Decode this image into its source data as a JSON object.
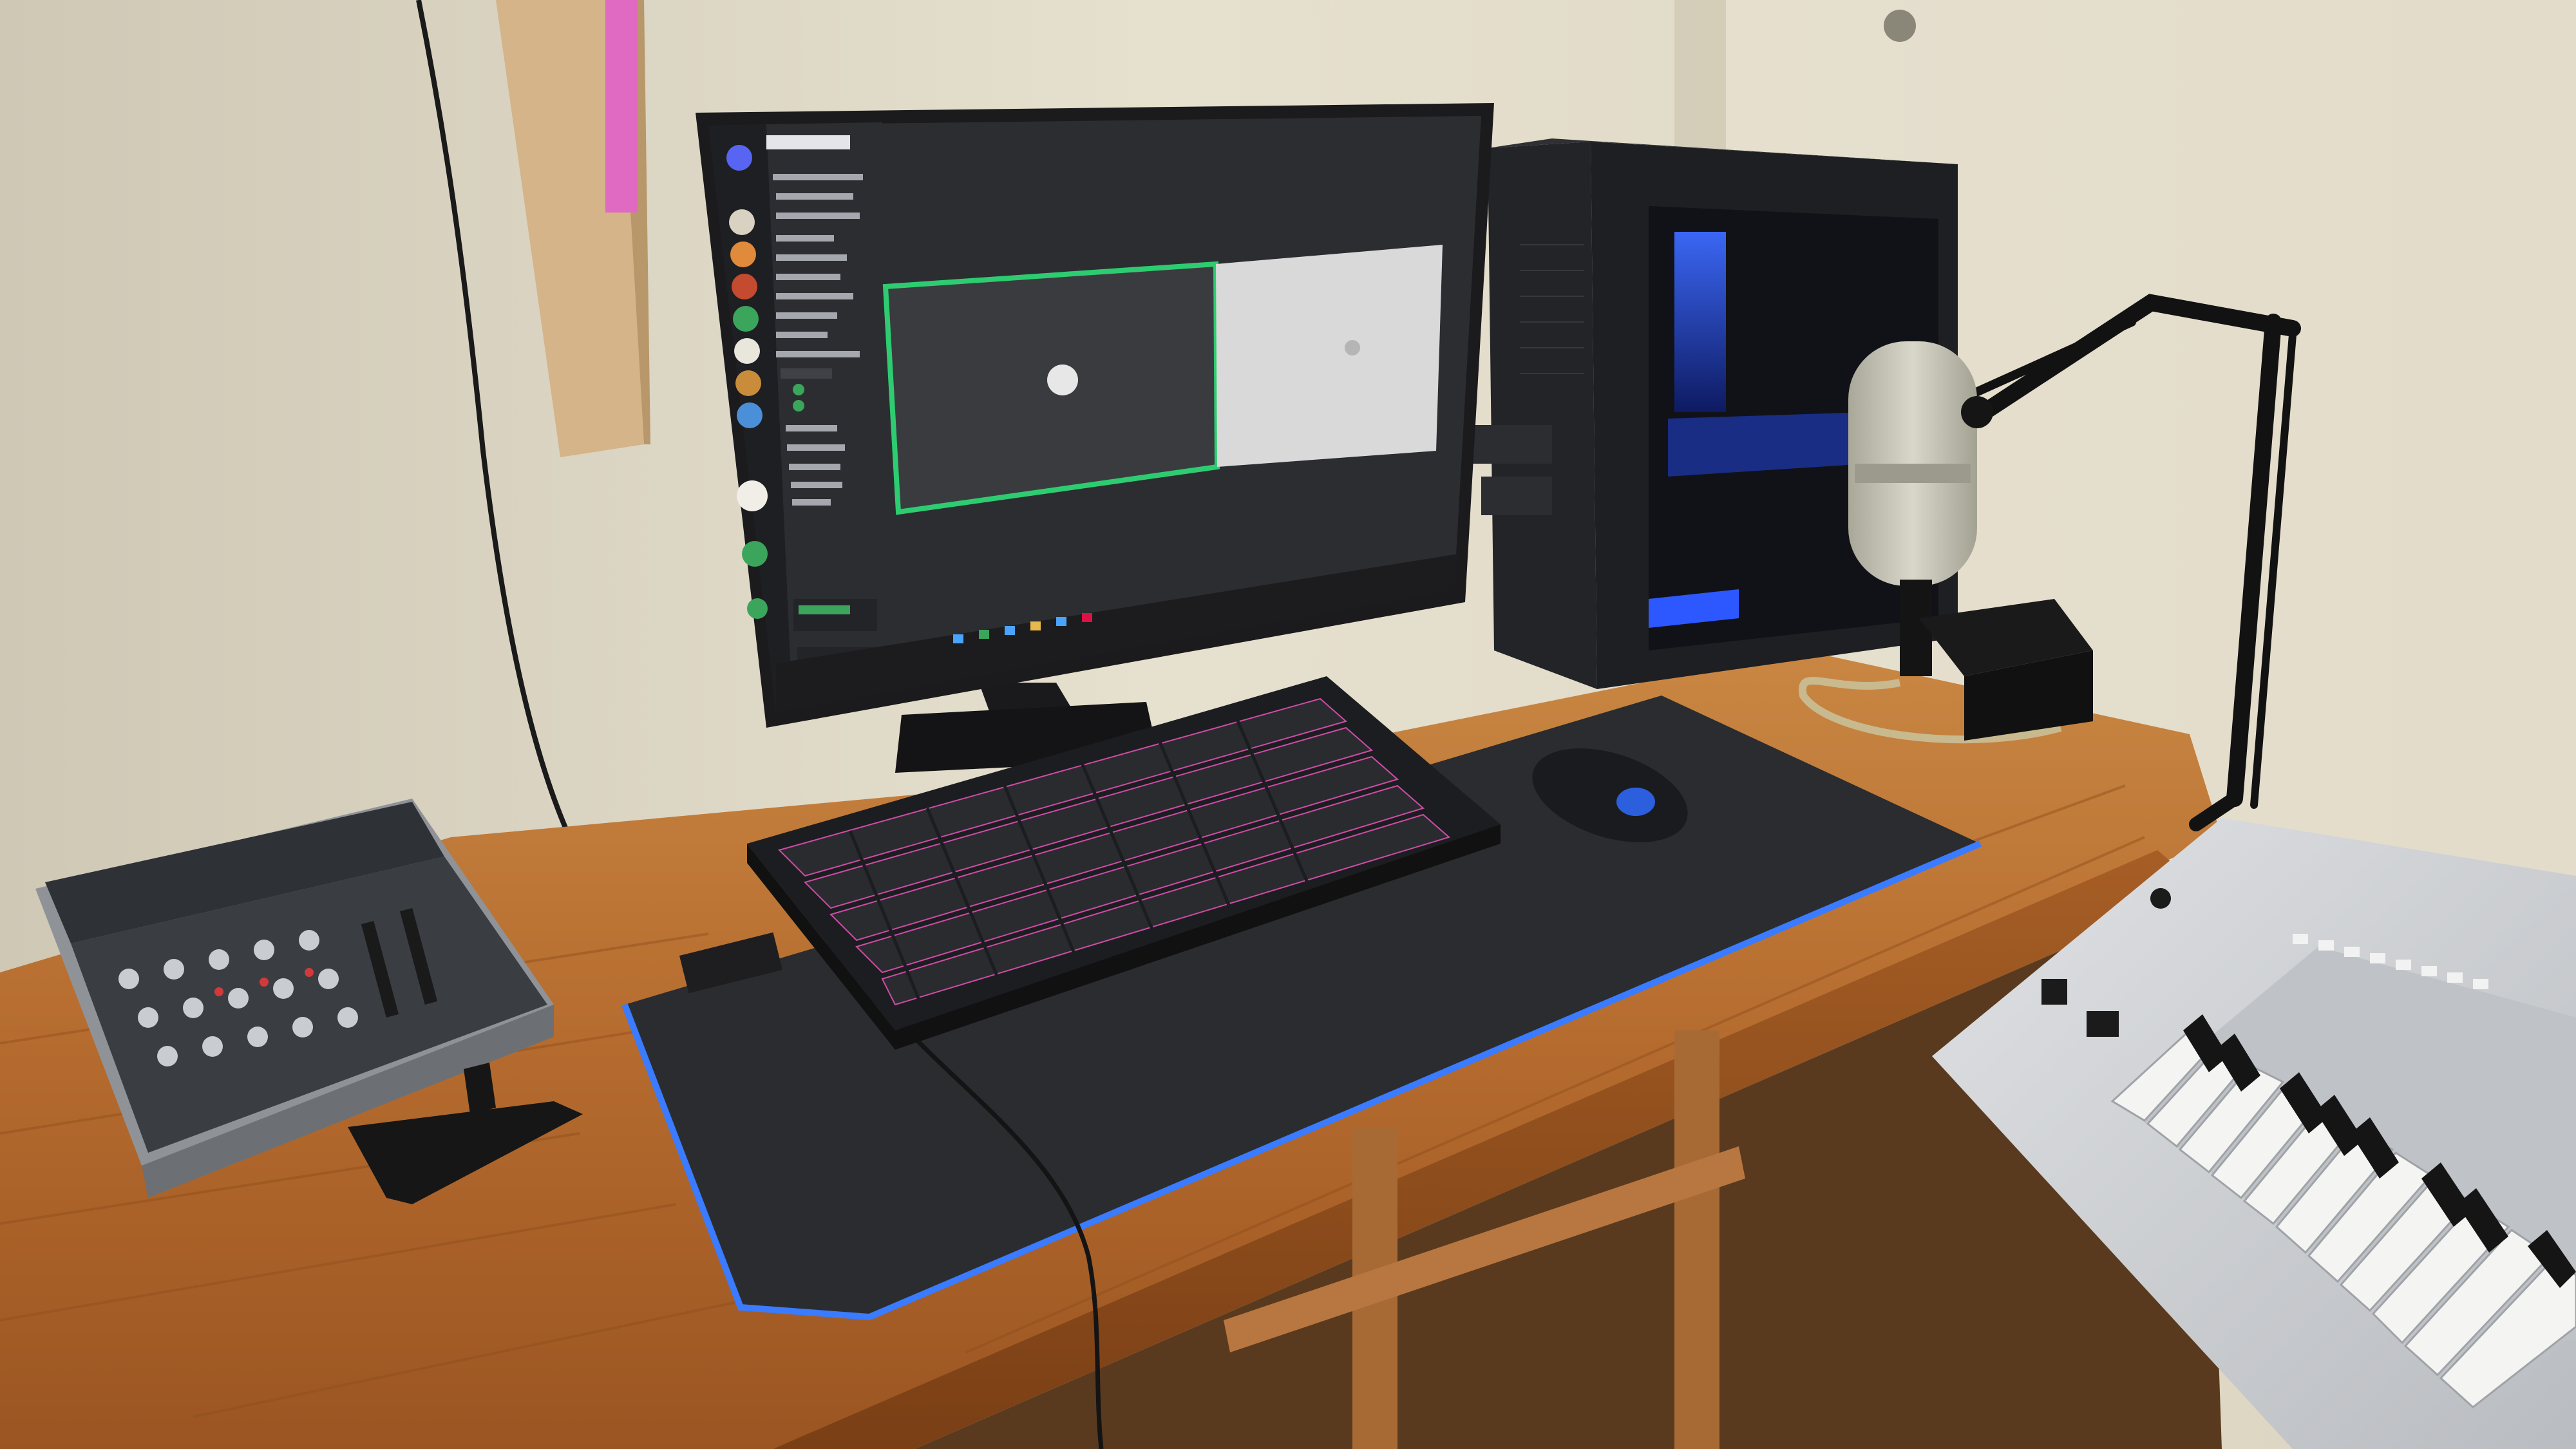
{
  "scene": {
    "description_type": "photo",
    "subject": "desk-setup"
  },
  "monitor": {
    "brand_badge": "",
    "screen_app": "voice-chat-app",
    "server_header": "",
    "channel_names": [
      "",
      "",
      "",
      "",
      "",
      "",
      "",
      ""
    ],
    "voice_channel_names": [
      "",
      "",
      "",
      "",
      "",
      ""
    ],
    "video_tiles": [
      {
        "state": "active-speaker",
        "border_color": "#2ecc71"
      },
      {
        "state": "idle",
        "border_color": "#cfcfcf"
      }
    ]
  },
  "colors": {
    "wall": "#e3dccb",
    "desk_wood": "#b9733a",
    "monitor_bezel": "#1b1b1d",
    "screen_dark": "#2b2d31",
    "mousepad": "#2a2c2f",
    "led_edge": "#3a7bff",
    "keyboard_led": "#d84fae",
    "pc_case": "#1d1f22",
    "pc_glow": "#2f5cff",
    "mic_body": "#c8c6b8",
    "keyboard_instrument": "#d3d5d8"
  },
  "icons": [
    "mixer-icon",
    "microphone-icon",
    "mouse-icon",
    "keyboard-icon",
    "pc-tower-icon",
    "piano-keyboard-icon"
  ]
}
